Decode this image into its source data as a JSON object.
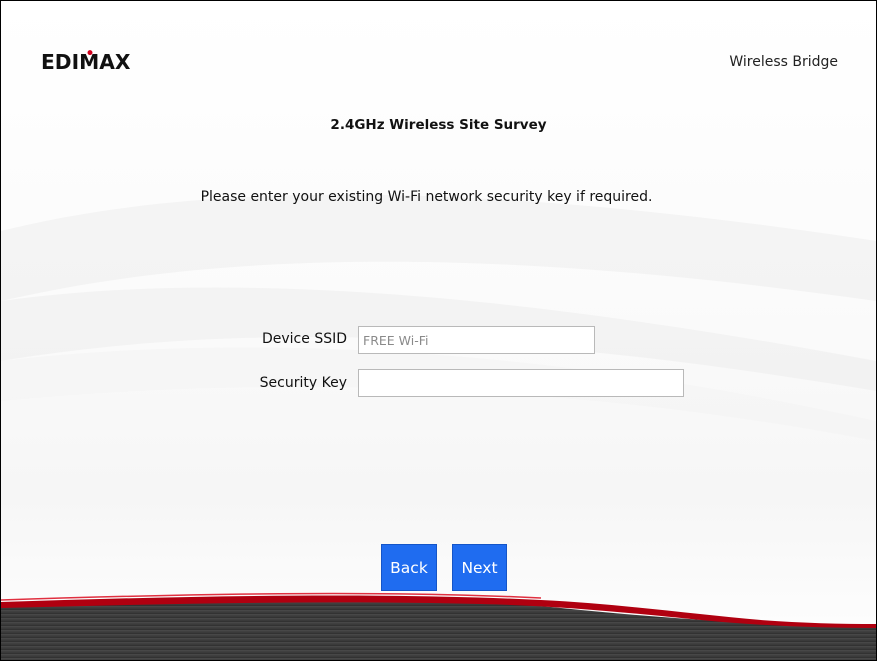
{
  "header": {
    "logo_text": "EDIMAX",
    "product_name": "Wireless Bridge"
  },
  "main": {
    "title": "2.4GHz Wireless Site Survey",
    "instruction": "Please enter your existing Wi-Fi network security key if required."
  },
  "form": {
    "device_ssid_label": "Device SSID",
    "device_ssid_value": "FREE Wi-Fi",
    "security_key_label": "Security Key",
    "security_key_value": ""
  },
  "buttons": {
    "back_label": "Back",
    "next_label": "Next"
  },
  "colors": {
    "button": "#1f6cf0",
    "footer_red": "#b00010",
    "footer_dark": "#3a3a3a"
  }
}
